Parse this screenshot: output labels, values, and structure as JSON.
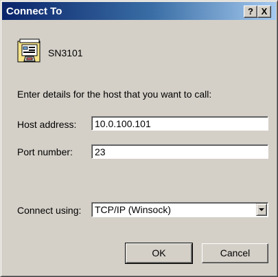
{
  "window": {
    "title": "Connect To",
    "help_glyph": "?",
    "close_glyph": "X"
  },
  "connection": {
    "name": "SN3101",
    "icon": "phone-connection-icon"
  },
  "instructions": "Enter details for the host that you want to call:",
  "fields": {
    "host_label": "Host address:",
    "host_value": "10.0.100.101",
    "port_label": "Port number:",
    "port_value": "23",
    "connect_label": "Connect using:",
    "connect_value": "TCP/IP (Winsock)"
  },
  "buttons": {
    "ok": "OK",
    "cancel": "Cancel"
  },
  "colors": {
    "dialog_bg": "#d4d0c8",
    "title_start": "#0a246a",
    "title_end": "#a6caf0"
  }
}
